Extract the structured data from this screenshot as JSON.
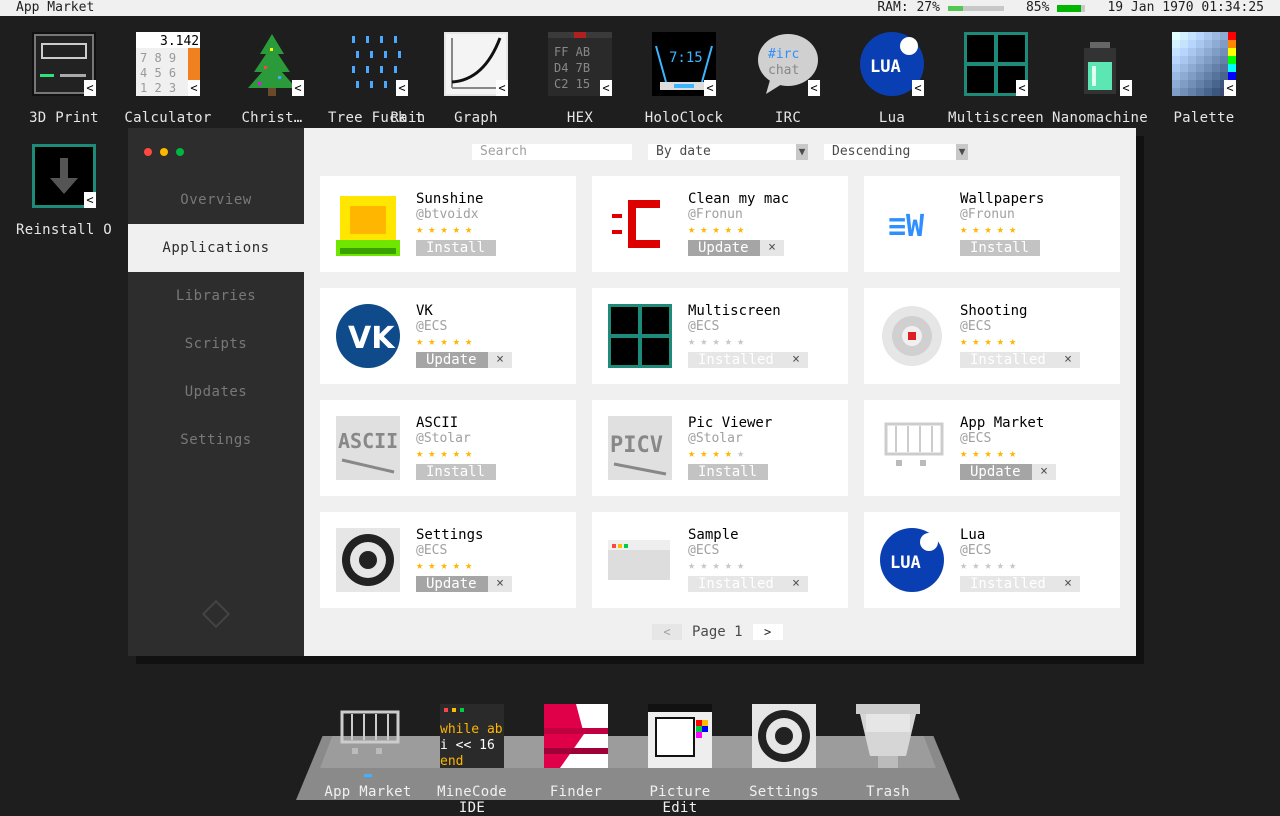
{
  "menubar": {
    "title": "App Market",
    "ram": "RAM: 27%",
    "ram_pct": 27,
    "battery": "85%",
    "battery_pct": 85,
    "datetime": "19 Jan 1970 01:34:25"
  },
  "desktop": [
    {
      "label": "3D Print",
      "icon": "3d-print-icon"
    },
    {
      "label": "Calculator",
      "icon": "calculator-icon",
      "icon_text": "3.142",
      "keys": [
        "7 8 9",
        "4 5 6",
        "1 2 3"
      ]
    },
    {
      "label": "Christ…",
      "icon": "christmas-tree-icon"
    },
    {
      "label": "Tree Fuck t…",
      "icon": "rain-drops-icon"
    },
    {
      "label": "Rain",
      "icon": "rain-icon"
    },
    {
      "label": "Graph",
      "icon": "graph-icon"
    },
    {
      "label": "HEX",
      "icon": "hex-icon",
      "icon_text": "FF AB D4 7B C2 15"
    },
    {
      "label": "HoloClock",
      "icon": "holoclock-icon",
      "icon_text": "7:15"
    },
    {
      "label": "IRC",
      "icon": "irc-icon",
      "icon_text": "#irc chat"
    },
    {
      "label": "Lua",
      "icon": "lua-icon",
      "icon_text": "LUA"
    },
    {
      "label": "Multiscreen",
      "icon": "multiscreen-icon"
    },
    {
      "label": "Nanomachines",
      "icon": "nanomachines-icon"
    },
    {
      "label": "Palette",
      "icon": "palette-icon"
    },
    {
      "label": "Reinstall OS R",
      "icon": "reinstall-icon"
    }
  ],
  "sidebar": {
    "items": [
      {
        "label": "Overview"
      },
      {
        "label": "Applications"
      },
      {
        "label": "Libraries"
      },
      {
        "label": "Scripts"
      },
      {
        "label": "Updates"
      },
      {
        "label": "Settings"
      }
    ],
    "active": "Applications"
  },
  "toolbar": {
    "search_placeholder": "Search",
    "sort": "By date",
    "order": "Descending",
    "arrow": "▼"
  },
  "cards": [
    {
      "name": "Sunshine",
      "author": "@btvoidx",
      "rating": 5,
      "button": "Install",
      "remove": false
    },
    {
      "name": "Clean my mac",
      "author": "@Fronun",
      "rating": 5,
      "button": "Update",
      "remove": true
    },
    {
      "name": "Wallpapers",
      "author": "@Fronun",
      "rating": 5,
      "button": "Install",
      "remove": false
    },
    {
      "name": "VK",
      "author": "@ECS",
      "rating": 5,
      "button": "Update",
      "remove": true
    },
    {
      "name": "Multiscreen",
      "author": "@ECS",
      "rating": 0,
      "button": "Installed",
      "remove": true
    },
    {
      "name": "Shooting",
      "author": "@ECS",
      "rating": 5,
      "button": "Installed",
      "remove": true
    },
    {
      "name": "ASCII",
      "author": "@Stolar",
      "rating": 5,
      "button": "Install",
      "remove": false
    },
    {
      "name": "Pic Viewer",
      "author": "@Stolar",
      "rating": 4,
      "button": "Install",
      "remove": false
    },
    {
      "name": "App Market",
      "author": "@ECS",
      "rating": 5,
      "button": "Update",
      "remove": true
    },
    {
      "name": "Settings",
      "author": "@ECS",
      "rating": 5,
      "button": "Update",
      "remove": true
    },
    {
      "name": "Sample",
      "author": "@ECS",
      "rating": 0,
      "button": "Installed",
      "remove": true
    },
    {
      "name": "Lua",
      "author": "@ECS",
      "rating": 0,
      "button": "Installed",
      "remove": true
    }
  ],
  "pager": {
    "label": "Page 1",
    "prev": "<",
    "next": ">"
  },
  "dock": [
    {
      "label": "App Market",
      "running": true
    },
    {
      "label": "MineCode IDE",
      "running": false,
      "code": [
        "while ab",
        " i << 16",
        "end"
      ]
    },
    {
      "label": "Finder",
      "running": false
    },
    {
      "label": "Picture Edit",
      "running": false
    },
    {
      "label": "Settings",
      "running": false
    },
    {
      "label": "Trash",
      "running": false
    }
  ],
  "symbols": {
    "star": "★",
    "close": "×",
    "arrow_open": "<"
  },
  "colors": {
    "accent": "#3cb4ff",
    "star": "#ffb600",
    "window_bg": "#f0f0f0",
    "sidebar": "#2d2d2d"
  }
}
